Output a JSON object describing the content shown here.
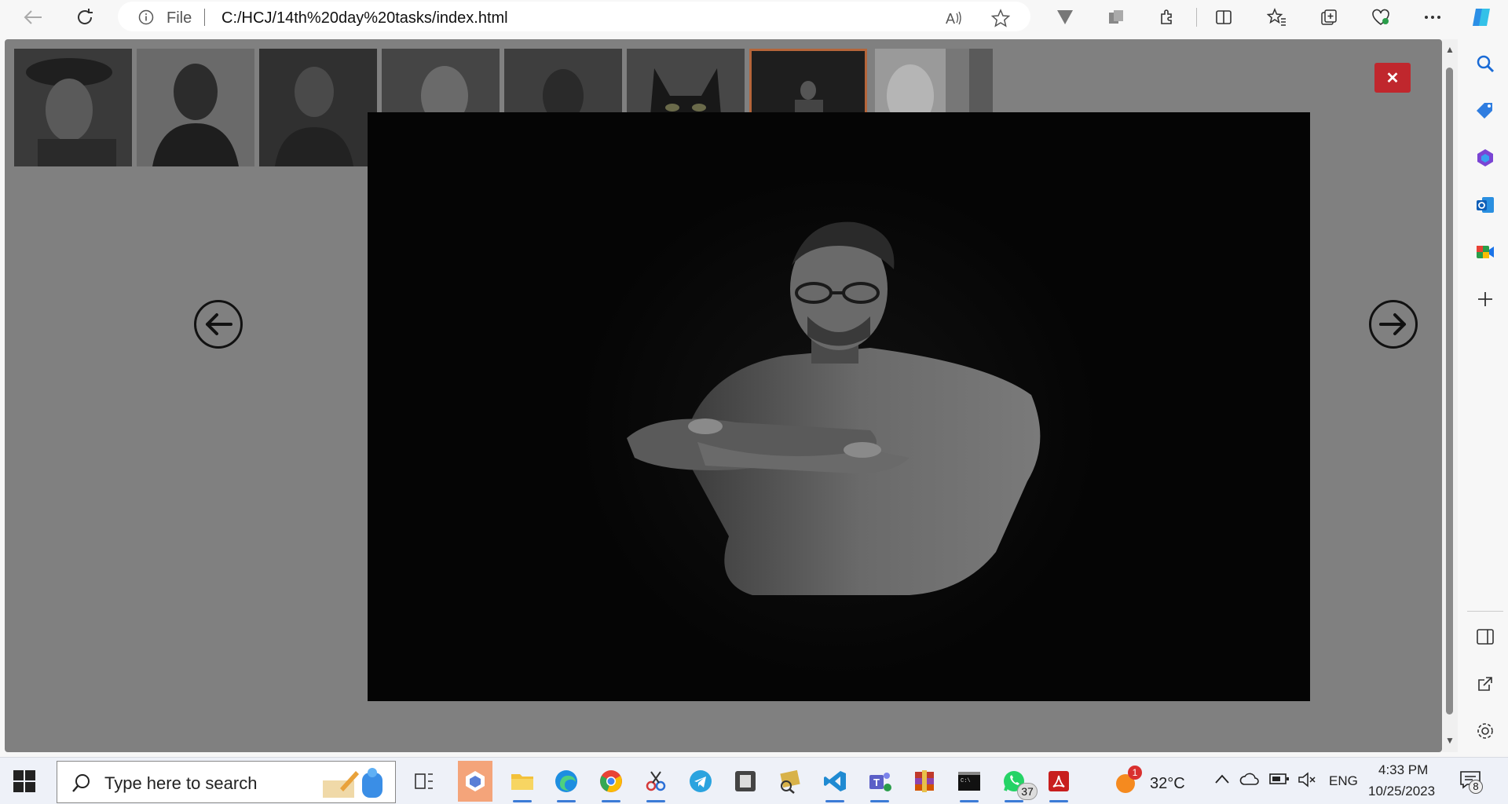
{
  "browser": {
    "file_label": "File",
    "url": "C:/HCJ/14th%20day%20tasks/index.html",
    "icons": [
      "back-arrow-icon",
      "refresh-icon",
      "info-icon",
      "read-aloud-icon",
      "favorite-star-icon",
      "vivaldi-extension-icon",
      "collections-icon",
      "extensions-puzzle-icon",
      "split-screen-icon",
      "favorites-icon",
      "add-collection-icon",
      "browser-essentials-icon",
      "more-menu-icon",
      "copilot-icon"
    ]
  },
  "sidebar": {
    "icons": [
      "search-icon",
      "shopping-tag-icon",
      "office-icon",
      "outlook-icon",
      "meet-icon",
      "add-icon",
      "sidebar-toggle-icon",
      "open-external-icon",
      "settings-gear-icon"
    ]
  },
  "gallery": {
    "thumbnails": [
      {
        "alt": "man in hat portrait"
      },
      {
        "alt": "smiling man portrait"
      },
      {
        "alt": "man portrait dark"
      },
      {
        "alt": "man face lit side"
      },
      {
        "alt": "man in shadow"
      },
      {
        "alt": "black cat"
      },
      {
        "alt": "man with glasses arms crossed",
        "selected": true
      },
      {
        "alt": "abstract light"
      }
    ],
    "close_symbol": "✕",
    "selected_color": "#b5653a",
    "close_color": "#c0272d"
  },
  "taskbar": {
    "search_placeholder": "Type here to search",
    "weather_temp": "32°C",
    "weather_badge": "1",
    "lang": "ENG",
    "time": "4:33 PM",
    "date": "10/25/2023",
    "notification_count": "8",
    "whatsapp_badge": "37",
    "apps": [
      "task-view-icon",
      "cube-app-icon",
      "file-explorer-icon",
      "edge-icon",
      "chrome-icon",
      "snipping-tool-icon",
      "telegram-icon",
      "notes-app-icon",
      "pictures-app-icon",
      "vscode-icon",
      "teams-icon",
      "winrar-icon",
      "terminal-icon",
      "whatsapp-icon",
      "acrobat-icon"
    ]
  }
}
